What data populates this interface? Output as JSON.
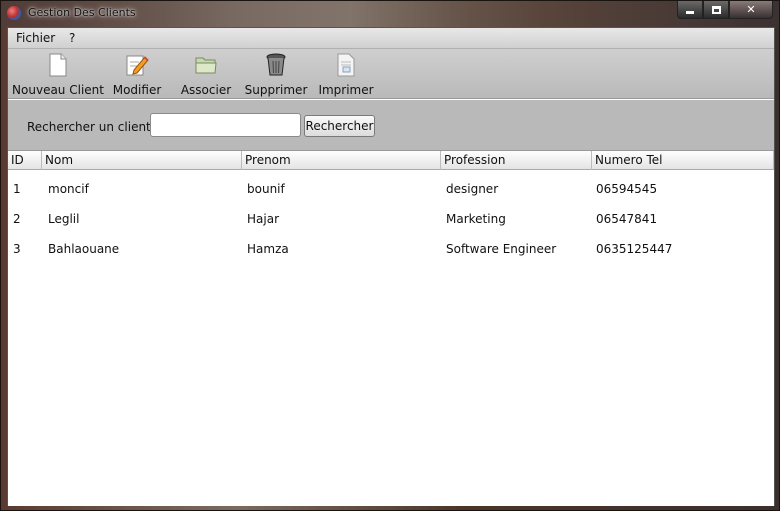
{
  "window": {
    "title": "Gestion Des Clients"
  },
  "menubar": {
    "items": [
      "Fichier",
      "?"
    ]
  },
  "toolbar": {
    "buttons": [
      {
        "label": "Nouveau Client",
        "icon": "new-document-icon"
      },
      {
        "label": "Modifier",
        "icon": "edit-pencil-icon"
      },
      {
        "label": "Associer",
        "icon": "folder-icon"
      },
      {
        "label": "Supprimer",
        "icon": "trash-icon"
      },
      {
        "label": "Imprimer",
        "icon": "print-document-icon"
      }
    ]
  },
  "search": {
    "label": "Rechercher un client",
    "value": "",
    "placeholder": "",
    "button_label": "Rechercher"
  },
  "table": {
    "columns": [
      "ID",
      "Nom",
      "Prenom",
      "Profession",
      "Numero Tel"
    ],
    "rows": [
      [
        "1",
        "moncif",
        "bounif",
        "designer",
        "06594545"
      ],
      [
        "2",
        "Leglil",
        "Hajar",
        "Marketing",
        "06547841"
      ],
      [
        "3",
        "Bahlaouane",
        "Hamza",
        "Software Engineer",
        "0635125447"
      ]
    ]
  }
}
